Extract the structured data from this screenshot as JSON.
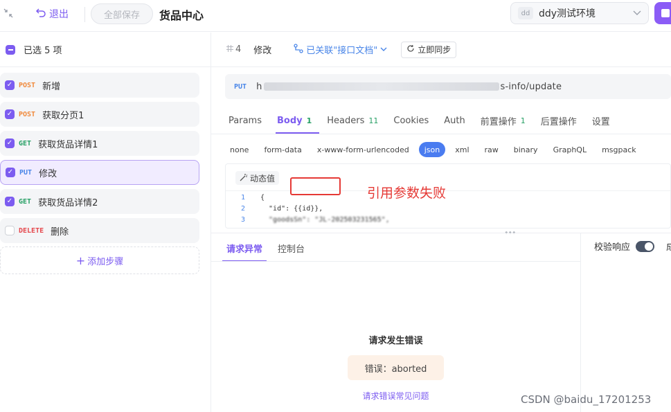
{
  "header": {
    "back_label": "退出",
    "save_all_label": "全部保存",
    "title": "货品中心",
    "env_badge": "dd",
    "env_name": "ddy测试环境"
  },
  "left": {
    "selected_label": "已选 5 项",
    "steps": [
      {
        "method": "POST",
        "name": "新增",
        "checked": true
      },
      {
        "method": "POST",
        "name": "获取分页1",
        "checked": true
      },
      {
        "method": "GET",
        "name": "获取货品详情1",
        "checked": true
      },
      {
        "method": "PUT",
        "name": "修改",
        "checked": true,
        "active": true
      },
      {
        "method": "GET",
        "name": "获取货品详情2",
        "checked": true
      },
      {
        "method": "DELETE",
        "name": "删除",
        "checked": false
      }
    ],
    "add_step_label": "添加步骤"
  },
  "request": {
    "step_number": "4",
    "step_title": "修改",
    "linked_label": "已关联\"接口文档\"",
    "sync_label": "立即同步",
    "method": "PUT",
    "url_visible_start": "h",
    "url_visible_end": "s-info/update",
    "tabs": [
      {
        "label": "Params",
        "count": ""
      },
      {
        "label": "Body",
        "count": "1"
      },
      {
        "label": "Headers",
        "count": "11"
      },
      {
        "label": "Cookies",
        "count": ""
      },
      {
        "label": "Auth",
        "count": ""
      },
      {
        "label": "前置操作",
        "count": "1"
      },
      {
        "label": "后置操作",
        "count": ""
      },
      {
        "label": "设置",
        "count": ""
      }
    ],
    "body_types": [
      "none",
      "form-data",
      "x-www-form-urlencoded",
      "json",
      "xml",
      "raw",
      "binary",
      "GraphQL",
      "msgpack"
    ],
    "active_body_type": "json",
    "dynamic_value_label": "动态值",
    "code_lines": [
      {
        "no": "1",
        "text": "{"
      },
      {
        "no": "2",
        "text": "  \"id\": {{id}},"
      },
      {
        "no": "3",
        "text": "  \"goodsSn\": \"JL-202503231565\","
      }
    ],
    "annotation": "引用参数失败"
  },
  "response": {
    "tabs": [
      "请求异常",
      "控制台"
    ],
    "verify_label": "校验响应",
    "verify_more": "成",
    "error_title": "请求发生错误",
    "error_detail": "错误：aborted",
    "error_link": "请求错误常见问题"
  },
  "watermark": "CSDN @baidu_17201253",
  "colors": {
    "accent": "#7c5cf0",
    "post": "#f08a3c",
    "get": "#27a065",
    "put": "#4a86e8",
    "delete": "#e5484d",
    "annotation": "#e53935"
  }
}
